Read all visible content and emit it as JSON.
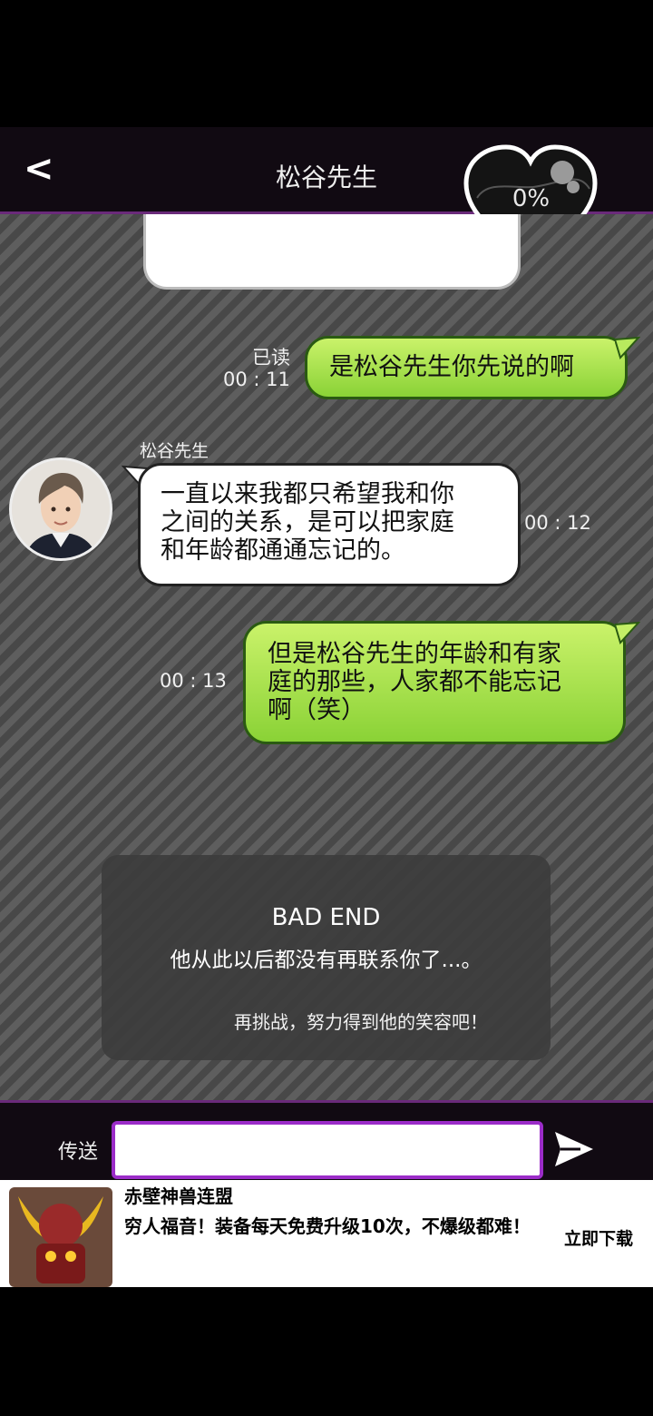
{
  "header": {
    "back_label": "<",
    "title": "松谷先生",
    "affection_percent": "0%"
  },
  "messages": [
    {
      "side": "right",
      "read_label": "已读",
      "time": "00 : 11",
      "text": "是松谷先生你先说的啊"
    },
    {
      "side": "left",
      "sender": "松谷先生",
      "time": "00 : 12",
      "lines": [
        "一直以来我都只希望我和你",
        "之间的关系，是可以把家庭",
        "和年龄都通通忘记的。"
      ]
    },
    {
      "side": "right",
      "time": "00 : 13",
      "lines": [
        "但是松谷先生的年龄和有家",
        "庭的那些，人家都不能忘记",
        "啊（笑）"
      ]
    }
  ],
  "ending": {
    "title": "BAD END",
    "subtitle": "他从此以后都没有再联系你了...。",
    "retry": "再挑战，努力得到他的笑容吧！"
  },
  "input_bar": {
    "send_label": "传送",
    "input_value": ""
  },
  "ad": {
    "title": "赤壁神兽连盟",
    "description": "穷人福音！装备每天免费升级10次，不爆级都难！",
    "cta": "立即下载"
  },
  "colors": {
    "accent_purple": "#9b2cc8",
    "bubble_green": "#a4e24a",
    "header_bg": "#110a12"
  }
}
